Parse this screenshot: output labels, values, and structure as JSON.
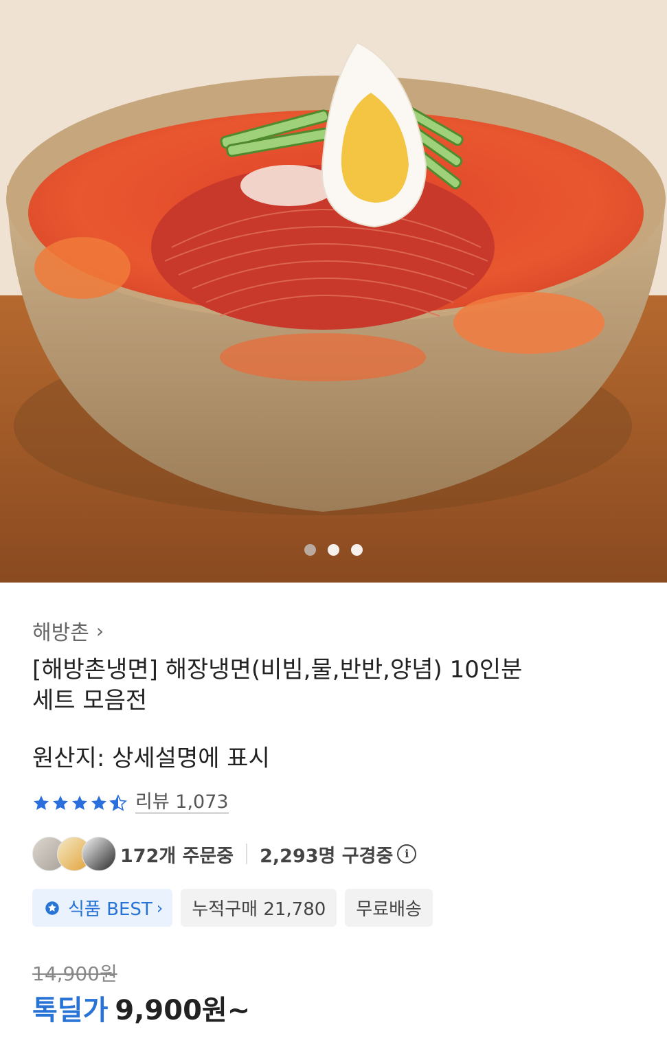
{
  "hero": {
    "image_label": "cold-noodle-bowl-photo",
    "carousel_count": 3,
    "carousel_active_index": 0
  },
  "product": {
    "brand": "해방촌",
    "title_line1": "[해방촌냉면] 해장냉면(비빔,물,반반,양념) 10인분",
    "title_line2": "세트 모음전",
    "origin": "원산지: 상세설명에 표시"
  },
  "rating": {
    "stars": 4.5,
    "review_label": "리뷰 1,073"
  },
  "social": {
    "orders": "172개 주문중",
    "viewers": "2,293명 구경중"
  },
  "badges": {
    "best": "식품 BEST",
    "cumulative": "누적구매 21,780",
    "shipping": "무료배송"
  },
  "price": {
    "original": "14,900원",
    "deal_label": "톡딜가",
    "deal_price": "9,900원~"
  },
  "colors": {
    "accent_blue": "#2773d6",
    "star_blue": "#2a6fdb",
    "badge_best_bg": "#e9f2fd"
  }
}
